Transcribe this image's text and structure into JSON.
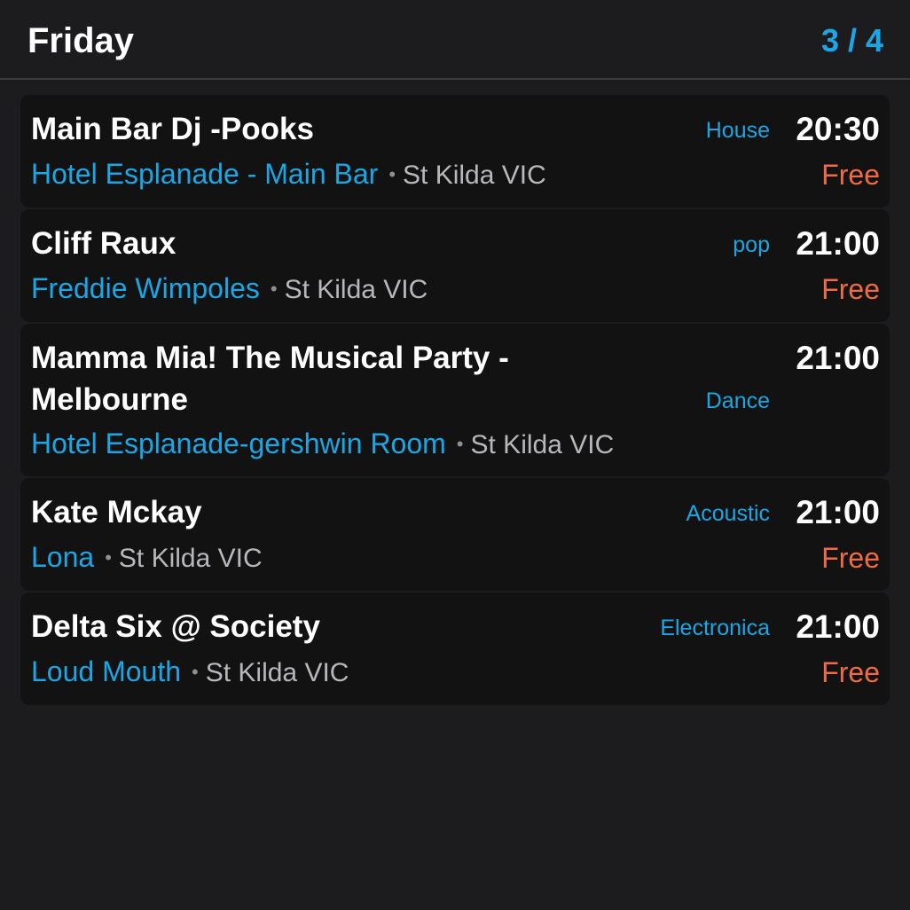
{
  "header": {
    "day": "Friday",
    "page_indicator": "3 / 4"
  },
  "events": [
    {
      "title": "Main Bar Dj -Pooks",
      "genre": "House",
      "time": "20:30",
      "venue": "Hotel Esplanade - Main Bar",
      "separator": "•",
      "location": "St Kilda VIC",
      "price": "Free"
    },
    {
      "title": "Cliff Raux",
      "genre": "pop",
      "time": "21:00",
      "venue": "Freddie Wimpoles",
      "separator": "•",
      "location": "St Kilda VIC",
      "price": "Free"
    },
    {
      "title": "Mamma Mia! The Musical Party - Melbourne",
      "genre": "Dance",
      "time": "21:00",
      "venue": "Hotel Esplanade-gershwin Room",
      "separator": "•",
      "location": "St Kilda VIC",
      "price": ""
    },
    {
      "title": "Kate Mckay",
      "genre": "Acoustic",
      "time": "21:00",
      "venue": "Lona",
      "separator": "•",
      "location": "St Kilda VIC",
      "price": "Free"
    },
    {
      "title": "Delta Six @ Society",
      "genre": "Electronica",
      "time": "21:00",
      "venue": "Loud Mouth",
      "separator": "•",
      "location": "St Kilda VIC",
      "price": "Free"
    }
  ],
  "colors": {
    "background": "#1c1c1e",
    "card": "#121212",
    "accent": "#1ba6e6",
    "price": "#f06a43",
    "text": "#ffffff",
    "muted": "#b8b8bc"
  }
}
